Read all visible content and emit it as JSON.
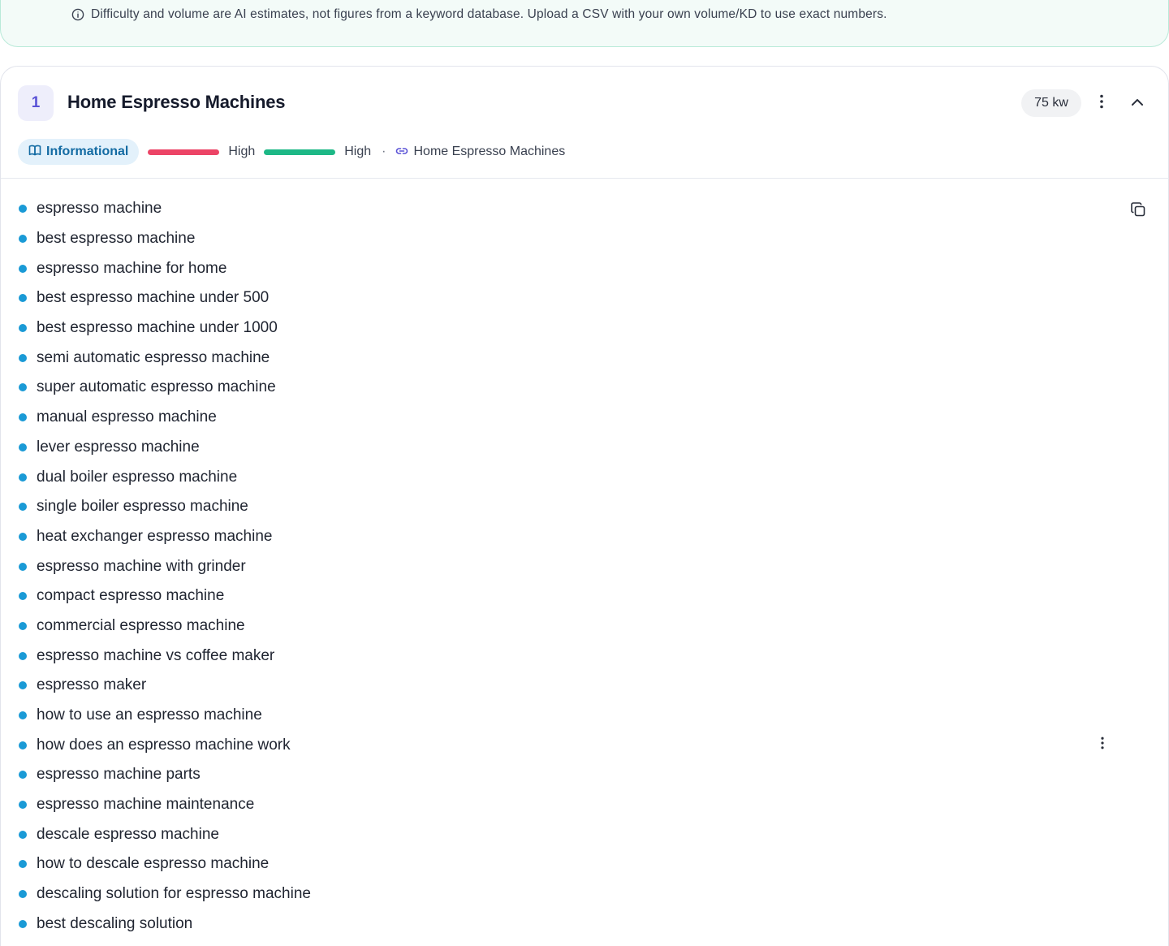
{
  "notice": {
    "text": "Difficulty and volume are AI estimates, not figures from a keyword database. Upload a CSV with your own volume/KD to use exact numbers.",
    "icon": "info-icon"
  },
  "cluster": {
    "number": "1",
    "title": "Home Espresso Machines",
    "keyword_count": "75 kw",
    "intent": "Informational",
    "difficulty_label": "High",
    "volume_label": "High",
    "separator": "·",
    "page_link": "Home Espresso Machines",
    "colors": {
      "intent_bg": "#e3f1fb",
      "intent_text": "#136ba3",
      "difficulty": "#ec4466",
      "volume": "#1db886",
      "bullet": "#1a9ad6",
      "accent": "#5a52d6"
    }
  },
  "keywords": [
    "espresso machine",
    "best espresso machine",
    "espresso machine for home",
    "best espresso machine under 500",
    "best espresso machine under 1000",
    "semi automatic espresso machine",
    "super automatic espresso machine",
    "manual espresso machine",
    "lever espresso machine",
    "dual boiler espresso machine",
    "single boiler espresso machine",
    "heat exchanger espresso machine",
    "espresso machine with grinder",
    "compact espresso machine",
    "commercial espresso machine",
    "espresso machine vs coffee maker",
    "espresso maker",
    "how to use an espresso machine",
    "how does an espresso machine work",
    "espresso machine parts",
    "espresso machine maintenance",
    "descale espresso machine",
    "how to descale espresso machine",
    "descaling solution for espresso machine",
    "best descaling solution"
  ]
}
